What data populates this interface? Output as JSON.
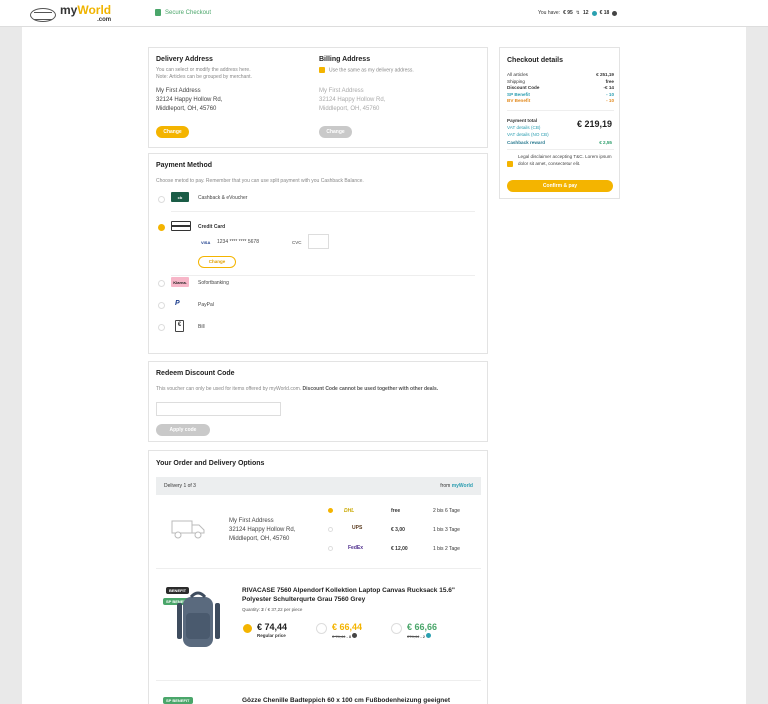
{
  "header": {
    "logo_main": "my",
    "logo_accent": "World",
    "logo_domain": ".com",
    "secure_label": "Secure Checkout",
    "balance_label": "You have:",
    "balance_1": "€ 95",
    "balance_2": "12",
    "balance_3": "€ 18"
  },
  "delivery": {
    "title": "Delivery Address",
    "note1": "You can select or modify the address here.",
    "note2": "Note: Articles can be grouped by merchant.",
    "addr1": "My First Address",
    "addr2": "32124 Happy Hollow Rd,",
    "addr3": "Middleport, OH, 45760",
    "change": "Change"
  },
  "billing": {
    "title": "Billing Address",
    "same_label": "Use the same as my delivery address.",
    "addr1": "My First Address",
    "addr2": "32124 Happy Hollow Rd,",
    "addr3": "Middleport, OH, 45760",
    "change": "Change"
  },
  "payment": {
    "title": "Payment Method",
    "note": "Choose metod to pay. Remember that you can use split payment with you Cashback Balance.",
    "cashback_label": "Cashback & eVoucher",
    "cashback_icon": "cb",
    "credit_label": "Credit Card",
    "visa": "VISA",
    "card_number": "1234 **** **** 5678",
    "cvc": "CVC",
    "change": "Change",
    "sofort_label": "Sofortbanking",
    "sofort_icon": "Klarna.",
    "paypal_label": "PayPal",
    "bill_label": "Bill"
  },
  "discount": {
    "title": "Redeem Discount Code",
    "note_plain": "This voucher can only be used for items offered by myWorld.com.",
    "note_bold": "Discount Code cannot be used together with other deals.",
    "apply": "Apply code"
  },
  "order": {
    "title": "Your Order and Delivery Options",
    "delivery_label": "Delivery 1 of 3",
    "from_label": "from",
    "from_merchant": "myWorld",
    "addr1": "My First Address",
    "addr2": "32124 Happy Hollow Rd,",
    "addr3": "Middleport, OH, 45760",
    "shipping": [
      {
        "carrier": "DHL",
        "price": "free",
        "time": "2 bis 6 Tage"
      },
      {
        "carrier": "UPS",
        "price": "€ 3,00",
        "time": "1 bis 3 Tage"
      },
      {
        "carrier": "FedEx",
        "price": "€ 12,00",
        "time": "1 bis 2 Tage"
      }
    ],
    "product1": {
      "badge1": "BENEFIT",
      "badge2": "SP BENEFIT",
      "name": "RIVACASE 7560 Alpendorf Kollektion Laptop Canvas Rucksack 15.6\" Polyester Schulterqurte Grau 7560 Grey",
      "qty_label": "Quantity:",
      "qty": "2",
      "unit": "/ € 37,22 per piece",
      "price1": "€ 74,44",
      "price1_label": "Regular price",
      "price2": "€ 66,44",
      "price2_old": "€ 74,44",
      "price2_save": "- 8",
      "price3": "€ 66,66",
      "price3_old": "€74,44",
      "price3_save": "- 2"
    },
    "product2": {
      "badge": "SP BENEFIT",
      "name": "Gözze Chenille Badteppich 60 x 100 cm Fußbodenheizung geeignet"
    }
  },
  "checkout": {
    "title": "Checkout details",
    "rows": [
      {
        "label": "All articles",
        "value": "€ 251,19",
        "cls": ""
      },
      {
        "label": "Shipping",
        "value": "free",
        "cls": ""
      },
      {
        "label": "Discount Code",
        "value": "-€ 14",
        "cls": "bold"
      },
      {
        "label": "SP Benefit",
        "value": "- 10",
        "cls": "teal"
      },
      {
        "label": "BV Benefit",
        "value": "- 10",
        "cls": "orng"
      }
    ],
    "total_label": "Payment total",
    "total_value": "€ 219,19",
    "vat1": "VAT details (CB)",
    "vat2": "VAT details (NO CB)",
    "cashback_label": "Cashback reward",
    "cashback_value": "€ 2,55",
    "legal": "Legal disclaimer accepting T&C. Lorem ipsum dolor sit amet, consectetur elit.",
    "confirm": "Confirm & pay"
  }
}
